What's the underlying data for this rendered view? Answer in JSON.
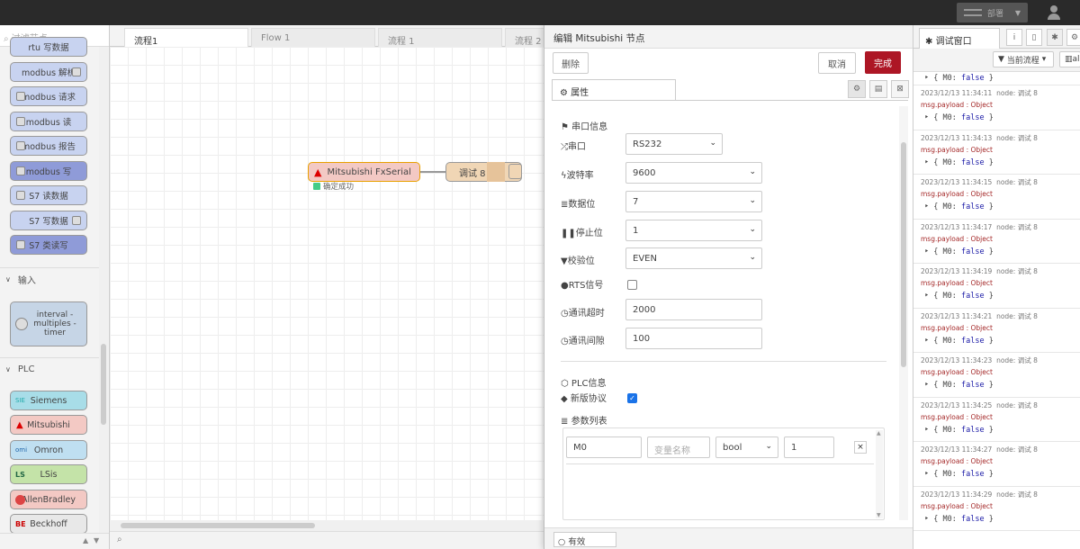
{
  "topbar": {
    "deploy_label": "部署"
  },
  "palette": {
    "search_placeholder": "过滤节点",
    "nodes_top": [
      {
        "label": "rtu 写数据"
      },
      {
        "label": "modbus 解析"
      },
      {
        "label": "modbus 请求"
      },
      {
        "label": "modbus 读"
      },
      {
        "label": "modbus 报告"
      },
      {
        "label": "modbus 写"
      },
      {
        "label": "S7 读数据"
      },
      {
        "label": "S7 写数据"
      },
      {
        "label": "S7 类读写"
      }
    ],
    "category_input": "输入",
    "interval_node": {
      "line1": "interval -",
      "line2": "multiples -",
      "line3": "timer"
    },
    "category_plc": "PLC",
    "plc_nodes": [
      {
        "label": "Siemens",
        "badge": "SIE",
        "color": "#a8dde8"
      },
      {
        "label": "Mitsubishi",
        "badge": "",
        "color": "#f3c9c4"
      },
      {
        "label": "Omron",
        "badge": "omi",
        "color": "#bfdff1"
      },
      {
        "label": "LSis",
        "badge": "LS",
        "color": "#c4e3a8"
      },
      {
        "label": "AllenBradley",
        "badge": "",
        "color": "#f3c9c4"
      },
      {
        "label": "Beckhoff",
        "badge": "BE",
        "color": "#e8e8e8"
      }
    ]
  },
  "workspace": {
    "tabs": [
      "流程1",
      "Flow 1",
      "流程 1",
      "流程 2"
    ],
    "node_mitsubishi": {
      "label": "Mitsubishi FxSerial",
      "status": "确定成功"
    },
    "node_debug": {
      "label": "调试 8"
    }
  },
  "editor": {
    "title": "编辑 Mitsubishi 节点",
    "delete_label": "删除",
    "cancel_label": "取消",
    "done_label": "完成",
    "tab_properties": "属性",
    "section_serial": "串口信息",
    "fields": {
      "port": {
        "label": "串口",
        "value": "RS232"
      },
      "baud": {
        "label": "波特率",
        "value": "9600"
      },
      "databits": {
        "label": "数据位",
        "value": "7"
      },
      "stopbits": {
        "label": "停止位",
        "value": "1"
      },
      "parity": {
        "label": "校验位",
        "value": "EVEN"
      },
      "rts": {
        "label": "RTS信号",
        "checked": false
      },
      "timeout": {
        "label": "通讯超时",
        "value": "2000"
      },
      "interval": {
        "label": "通讯间隙",
        "value": "100"
      }
    },
    "section_plc": "PLC信息",
    "new_protocol": {
      "label": "新版协议",
      "checked": true
    },
    "param_list_label": "参数列表",
    "param_row": {
      "address": "M0",
      "name_placeholder": "变量名称",
      "type": "bool",
      "count": "1",
      "remove": "×"
    },
    "footer_label": "有效"
  },
  "sidebar": {
    "tab_label": "调试窗口",
    "filter_label": "当前流程",
    "clear_label": "al",
    "first_payload": {
      "key": "M0",
      "value": "false"
    },
    "messages": [
      {
        "time": "2023/12/13 11:34:11",
        "node": "node: 调试 8",
        "topic": "msg.payload : Object",
        "key": "M0",
        "value": "false"
      },
      {
        "time": "2023/12/13 11:34:13",
        "node": "node: 调试 8",
        "topic": "msg.payload : Object",
        "key": "M0",
        "value": "false"
      },
      {
        "time": "2023/12/13 11:34:15",
        "node": "node: 调试 8",
        "topic": "msg.payload : Object",
        "key": "M0",
        "value": "false"
      },
      {
        "time": "2023/12/13 11:34:17",
        "node": "node: 调试 8",
        "topic": "msg.payload : Object",
        "key": "M0",
        "value": "false"
      },
      {
        "time": "2023/12/13 11:34:19",
        "node": "node: 调试 8",
        "topic": "msg.payload : Object",
        "key": "M0",
        "value": "false"
      },
      {
        "time": "2023/12/13 11:34:21",
        "node": "node: 调试 8",
        "topic": "msg.payload : Object",
        "key": "M0",
        "value": "false"
      },
      {
        "time": "2023/12/13 11:34:23",
        "node": "node: 调试 8",
        "topic": "msg.payload : Object",
        "key": "M0",
        "value": "false"
      },
      {
        "time": "2023/12/13 11:34:25",
        "node": "node: 调试 8",
        "topic": "msg.payload : Object",
        "key": "M0",
        "value": "false"
      },
      {
        "time": "2023/12/13 11:34:27",
        "node": "node: 调试 8",
        "topic": "msg.payload : Object",
        "key": "M0",
        "value": "false"
      },
      {
        "time": "2023/12/13 11:34:29",
        "node": "node: 调试 8",
        "topic": "msg.payload : Object",
        "key": "M0",
        "value": "false"
      }
    ]
  }
}
